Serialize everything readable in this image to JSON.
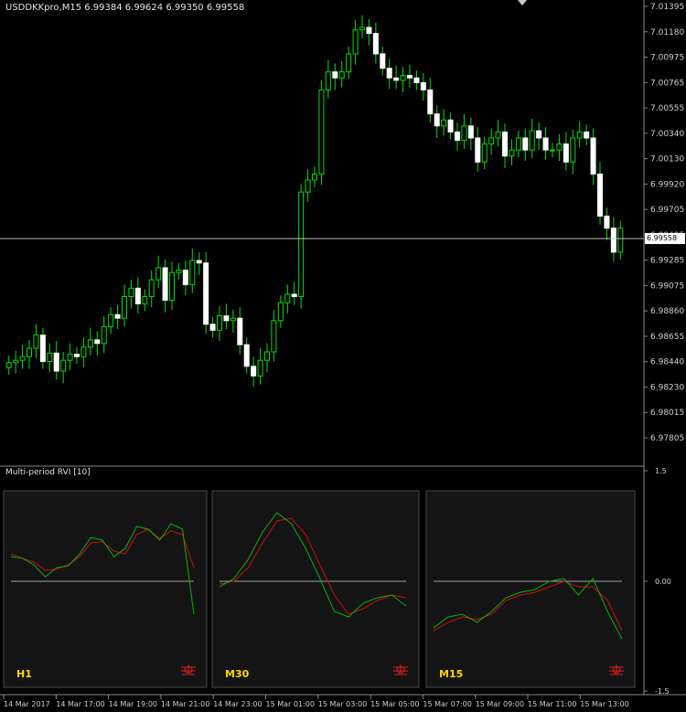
{
  "header": {
    "symbol_info": "USDDKKpro,M15  6.99384 6.99624 6.99350 6.99558"
  },
  "price_axis": {
    "labels": [
      "7.01395",
      "7.01180",
      "7.00975",
      "7.00765",
      "7.00555",
      "7.00340",
      "7.00130",
      "6.99920",
      "6.99705",
      "6.99495",
      "6.99285",
      "6.99075",
      "6.98860",
      "6.98655",
      "6.98440",
      "6.98230",
      "6.98015",
      "6.97805"
    ],
    "current_price": "6.99558"
  },
  "time_axis": {
    "labels": [
      "14 Mar 2017",
      "14 Mar 17:00",
      "14 Mar 19:00",
      "14 Mar 21:00",
      "14 Mar 23:00",
      "15 Mar 01:00",
      "15 Mar 03:00",
      "15 Mar 05:00",
      "15 Mar 07:00",
      "15 Mar 09:00",
      "15 Mar 11:00",
      "15 Mar 13:00"
    ]
  },
  "indicator": {
    "title": "Multi-period RVI [10]",
    "axis_labels": [
      "1.5",
      "0.00",
      "-1.5"
    ],
    "panels": [
      {
        "label": "H1",
        "green": [
          0.45,
          0.42,
          0.3,
          0.08,
          0.25,
          0.28,
          0.5,
          0.8,
          0.75,
          0.45,
          0.6,
          1.0,
          0.95,
          0.75,
          1.05,
          0.95,
          -0.6
        ],
        "red": [
          0.5,
          0.42,
          0.35,
          0.2,
          0.22,
          0.3,
          0.45,
          0.7,
          0.72,
          0.55,
          0.5,
          0.85,
          0.95,
          0.78,
          0.92,
          0.85,
          0.25
        ]
      },
      {
        "label": "M30",
        "green": [
          -0.1,
          0.05,
          0.4,
          0.9,
          1.25,
          1.05,
          0.6,
          0.05,
          -0.55,
          -0.65,
          -0.4,
          -0.3,
          -0.25,
          -0.45
        ],
        "red": [
          -0.05,
          0.0,
          0.25,
          0.7,
          1.1,
          1.15,
          0.85,
          0.3,
          -0.25,
          -0.6,
          -0.5,
          -0.35,
          -0.25,
          -0.3
        ]
      },
      {
        "label": "M15",
        "green": [
          -0.85,
          -0.65,
          -0.6,
          -0.75,
          -0.55,
          -0.3,
          -0.2,
          -0.15,
          0.0,
          0.05,
          -0.25,
          0.05,
          -0.55,
          -1.05
        ],
        "red": [
          -0.9,
          -0.75,
          -0.65,
          -0.7,
          -0.6,
          -0.35,
          -0.25,
          -0.2,
          -0.1,
          0.0,
          -0.1,
          -0.1,
          -0.35,
          -0.9
        ]
      }
    ]
  },
  "chart_data": {
    "type": "candlestick",
    "y_range": [
      6.97805,
      7.01395
    ],
    "current_price": 6.99558,
    "closes": [
      6.9843,
      6.9845,
      6.9848,
      6.9855,
      6.9866,
      6.9844,
      6.9851,
      6.9836,
      6.9845,
      6.985,
      6.9848,
      6.9856,
      6.9862,
      6.9859,
      6.9873,
      6.9883,
      6.988,
      6.9898,
      6.9905,
      6.9892,
      6.9898,
      6.9912,
      6.9922,
      6.9895,
      6.9918,
      6.992,
      6.9908,
      6.9928,
      6.9926,
      6.9875,
      6.987,
      6.9882,
      6.9878,
      6.988,
      6.9858,
      6.984,
      6.9832,
      6.9845,
      6.9852,
      6.9878,
      6.9893,
      6.99,
      6.9898,
      6.9985,
      6.9995,
      7.0,
      7.007,
      7.0085,
      7.008,
      7.0085,
      7.01,
      7.012,
      7.0122,
      7.0117,
      7.01,
      7.0088,
      7.008,
      7.0078,
      7.0082,
      7.008,
      7.0076,
      7.007,
      7.005,
      7.004,
      7.0045,
      7.0035,
      7.0028,
      7.004,
      7.003,
      7.001,
      7.0025,
      7.003,
      7.0035,
      7.0015,
      7.002,
      7.003,
      7.002,
      7.0036,
      7.003,
      7.002,
      7.002,
      7.0025,
      7.001,
      7.003,
      7.0035,
      7.003,
      7.0,
      6.9965,
      6.9955,
      6.9935,
      6.9955
    ]
  }
}
